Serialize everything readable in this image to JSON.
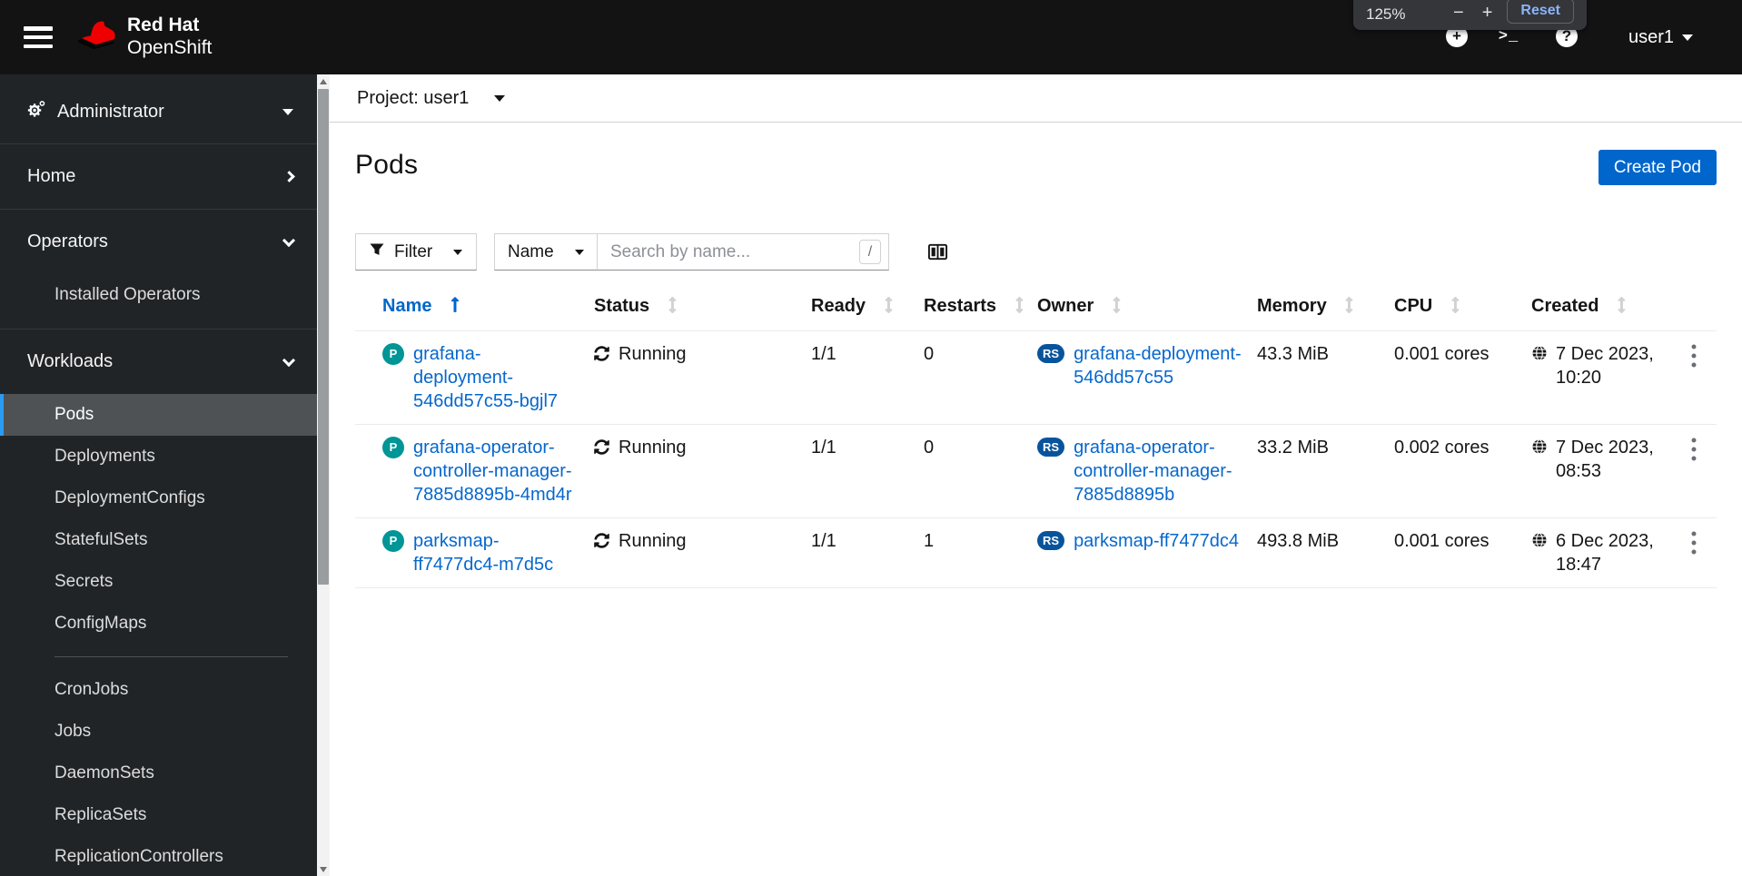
{
  "masthead": {
    "brand": {
      "line1": "Red Hat",
      "line2": "OpenShift"
    },
    "zoom_popup": {
      "level": "125%",
      "minus": "−",
      "plus": "+",
      "reset": "Reset"
    },
    "icons": {
      "plus": "+",
      "terminal": ">_",
      "help": "?"
    },
    "user": "user1"
  },
  "sidebar": {
    "perspective": "Administrator",
    "home": "Home",
    "operators": {
      "label": "Operators",
      "items": [
        "Installed Operators"
      ]
    },
    "workloads": {
      "label": "Workloads",
      "selected": "Pods",
      "items": [
        "Pods",
        "Deployments",
        "DeploymentConfigs",
        "StatefulSets",
        "Secrets",
        "ConfigMaps",
        "CronJobs",
        "Jobs",
        "DaemonSets",
        "ReplicaSets",
        "ReplicationControllers"
      ]
    }
  },
  "page": {
    "project_label": "Project: user1",
    "title": "Pods",
    "create_button": "Create Pod",
    "toolbar": {
      "filter": "Filter",
      "name_filter": "Name",
      "search_placeholder": "Search by name...",
      "shortcut": "/"
    }
  },
  "table": {
    "columns": [
      "Name",
      "Status",
      "Ready",
      "Restarts",
      "Owner",
      "Memory",
      "CPU",
      "Created"
    ],
    "sorted_column": "Name",
    "pod_badge": "P",
    "owner_badge": "RS",
    "rows": [
      {
        "name": "grafana-deployment-546dd57c55-bgjl7",
        "status": "Running",
        "ready": "1/1",
        "restarts": "0",
        "owner": "grafana-deployment-546dd57c55",
        "memory": "43.3 MiB",
        "cpu": "0.001 cores",
        "created": "7 Dec 2023, 10:20"
      },
      {
        "name": "grafana-operator-controller-manager-7885d8895b-4md4r",
        "status": "Running",
        "ready": "1/1",
        "restarts": "0",
        "owner": "grafana-operator-controller-manager-7885d8895b",
        "memory": "33.2 MiB",
        "cpu": "0.002 cores",
        "created": "7 Dec 2023, 08:53"
      },
      {
        "name": "parksmap-ff7477dc4-m7d5c",
        "status": "Running",
        "ready": "1/1",
        "restarts": "1",
        "owner": "parksmap-ff7477dc4",
        "memory": "493.8 MiB",
        "cpu": "0.001 cores",
        "created": "6 Dec 2023, 18:47"
      }
    ]
  },
  "colors": {
    "accent": "#0066cc",
    "pod_badge": "#009596",
    "owner_badge": "#08549c",
    "nav_selected_bg": "#4f5255",
    "nav_current_border": "#2b9af3",
    "masthead_bg": "#131313",
    "sidebar_bg": "#212427"
  }
}
